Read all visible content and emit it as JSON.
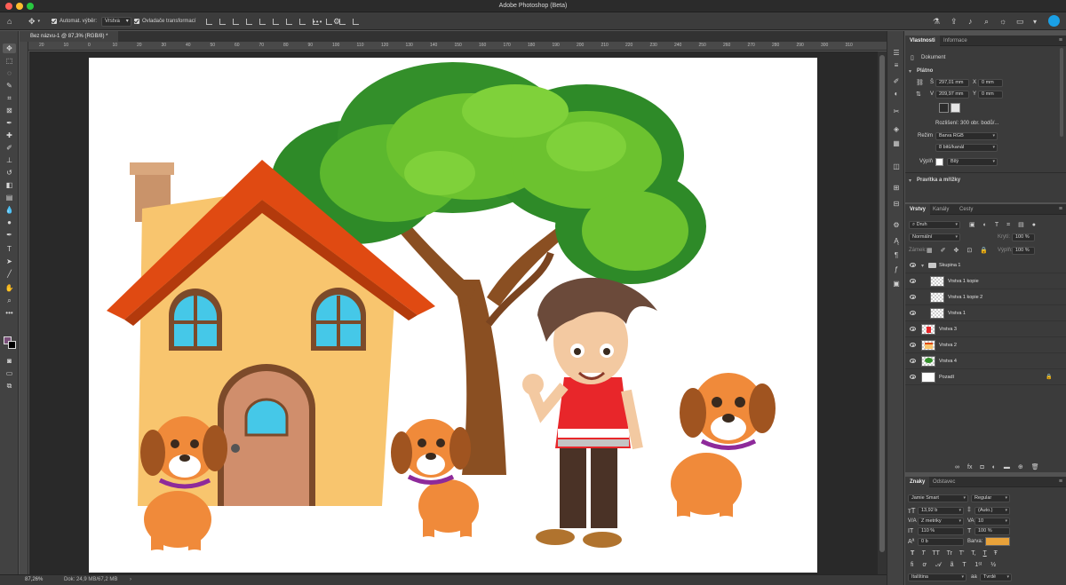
{
  "window": {
    "title": "Adobe Photoshop (Beta)"
  },
  "options_bar": {
    "auto_select_label": "Automat. výběr:",
    "auto_select_value": "Vrstva",
    "transform_label": "Ovladače transformací",
    "more_label": "•••"
  },
  "document": {
    "tab_label": "Bez názvu-1 @ 87,3% (RGB/8) *",
    "zoom": "87,26%",
    "doc_info": "Dok: 24,9 MB/67,2 MB",
    "ruler_ticks": [
      "20",
      "10",
      "0",
      "10",
      "20",
      "30",
      "40",
      "50",
      "60",
      "70",
      "80",
      "90",
      "100",
      "110",
      "120",
      "130",
      "140",
      "150",
      "160",
      "170",
      "180",
      "190",
      "200",
      "210",
      "220",
      "230",
      "240",
      "250",
      "260",
      "270",
      "280",
      "290",
      "300",
      "310"
    ]
  },
  "properties_panel": {
    "tabs": [
      "Vlastnosti",
      "Informace"
    ],
    "doc_label": "Dokument",
    "canvas_section": "Plátno",
    "width_label": "Š",
    "width_value": "297,01 mm",
    "height_label": "V",
    "height_value": "209,97 mm",
    "x_label": "X",
    "x_placeholder": "0 mm",
    "y_label": "Y",
    "y_placeholder": "0 mm",
    "resolution": "Rozlišení: 300 obr. bodů/...",
    "mode_label": "Režim",
    "mode_value": "Barva RGB",
    "depth_value": "8 bitů/kanál",
    "fill_label": "Výplň",
    "fill_value": "Bílý",
    "rulers_section": "Pravítka a mřížky"
  },
  "layers_panel": {
    "tabs": [
      "Vrstvy",
      "Kanály",
      "Cesty"
    ],
    "filter_value": "Druh",
    "blend_mode": "Normální",
    "opacity_label": "Krytí:",
    "opacity_value": "100 %",
    "lock_label": "Zámek:",
    "fill_label": "Výplň:",
    "fill_value": "100 %",
    "layers": [
      {
        "name": "Skupina 1",
        "kind": "group"
      },
      {
        "name": "Vrstva 1 kopie",
        "kind": "child"
      },
      {
        "name": "Vrstva 1 kopie 2",
        "kind": "child"
      },
      {
        "name": "Vrstva 1",
        "kind": "child"
      },
      {
        "name": "Vrstva 3",
        "kind": "layer"
      },
      {
        "name": "Vrstva 2",
        "kind": "layer"
      },
      {
        "name": "Vrstva 4",
        "kind": "layer"
      },
      {
        "name": "Pozadí",
        "kind": "background"
      }
    ]
  },
  "character_panel": {
    "tabs": [
      "Znaky",
      "Odstavec"
    ],
    "font_family": "Jamie Smart",
    "font_style": "Regular",
    "font_size": "13,92 b",
    "leading": "(Auto.)",
    "kerning": "Z metriky",
    "tracking": "10",
    "vscale": "110 %",
    "hscale": "100 %",
    "baseline": "0 b",
    "color_label": "Barva:",
    "color_value": "#e8a23a",
    "language": "Italština",
    "antialias": "Tvrdé",
    "style_buttons": [
      "T",
      "T",
      "TT",
      "Tr",
      "T'",
      "T,",
      "T",
      "Ŧ"
    ]
  },
  "colors": {
    "accent": "#1aa0e6",
    "foreground_swatch": "#7a4f7a",
    "background_swatch": "#000000"
  }
}
